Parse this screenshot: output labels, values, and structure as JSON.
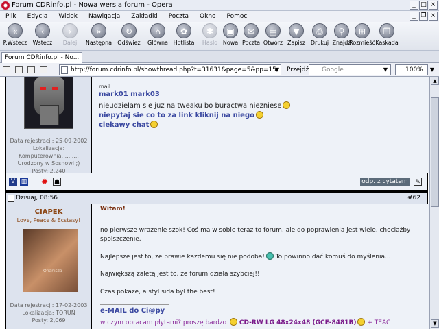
{
  "window": {
    "title": "Forum CDRinfo.pl - Nowa wersja forum - Opera"
  },
  "menu": [
    "Plik",
    "Edycja",
    "Widok",
    "Nawigacja",
    "Zakładki",
    "Poczta",
    "Okno",
    "Pomoc"
  ],
  "toolbar": [
    {
      "label": "P.Wstecz",
      "icon": "rewind-icon",
      "glyph": "«",
      "enabled": true
    },
    {
      "label": "Wstecz",
      "icon": "back-icon",
      "glyph": "‹",
      "enabled": true
    },
    {
      "label": "Dalej",
      "icon": "forward-icon",
      "glyph": "›",
      "enabled": false
    },
    {
      "label": "Następna",
      "icon": "fast-forward-icon",
      "glyph": "»",
      "enabled": true
    },
    {
      "label": "Odśwież",
      "icon": "reload-icon",
      "glyph": "↻",
      "enabled": true
    },
    {
      "label": "Główna",
      "icon": "home-icon",
      "glyph": "⌂",
      "enabled": true
    },
    {
      "label": "Hotlista",
      "icon": "hotlist-icon",
      "glyph": "✿",
      "enabled": true
    },
    {
      "label": "Hasło",
      "icon": "password-icon",
      "glyph": "✱",
      "enabled": false
    },
    {
      "label": "Nowa",
      "icon": "new-page-icon",
      "glyph": "▣",
      "enabled": true
    },
    {
      "label": "Poczta",
      "icon": "mail-icon",
      "glyph": "✉",
      "enabled": true
    },
    {
      "label": "Otwórz",
      "icon": "open-icon",
      "glyph": "▤",
      "enabled": true
    },
    {
      "label": "Zapisz",
      "icon": "save-icon",
      "glyph": "▼",
      "enabled": true
    },
    {
      "label": "Drukuj",
      "icon": "print-icon",
      "glyph": "⎙",
      "enabled": true
    },
    {
      "label": "Znajdź",
      "icon": "find-icon",
      "glyph": "⚲",
      "enabled": true
    },
    {
      "label": "Rozmieść",
      "icon": "tile-icon",
      "glyph": "⊞",
      "enabled": true
    },
    {
      "label": "Kaskada",
      "icon": "cascade-icon",
      "glyph": "❐",
      "enabled": true
    }
  ],
  "tab": {
    "label": "Forum CDRinfo.pl - No..."
  },
  "address": {
    "url": "http://forum.cdrinfo.pl/showthread.php?t=31631&page=5&pp=15",
    "goto": "Przejdź",
    "search_placeholder": "Google",
    "zoom": "100%"
  },
  "post1": {
    "info": [
      "Data rejestracji: 25-09-2002",
      "Lokalizacja:",
      "Komputerownia..........",
      "Urodzony w Sosnowi ;)",
      "Posty: 2,240"
    ],
    "mail": "mail",
    "lines": [
      "mark01 mark03",
      "nieudzielam sie juz na tweaku bo buractwa niezniese",
      "niepytaj sie co to za link kliknij na niego",
      "ciekawy chat"
    ],
    "quote": "odp. z cytatem"
  },
  "post2": {
    "date": "Dzisiaj, 08:56",
    "number": "#62",
    "username": "CIAPEK",
    "usertag": "Love, Peace & Ecstasy!",
    "avatar_text": "Onanisza",
    "info": [
      "Data rejestracji: 17-02-2003",
      "Lokalizacja: TORUŃ",
      "Posty: 2,069"
    ],
    "title": "Witam!",
    "paragraphs": [
      "no pierwsze wrażenie szok! Coś ma w sobie teraz to forum, ale do poprawienia jest wiele, chociażby spolszczenie.",
      "Najlepsze jest to, że prawie każdemu się nie podoba!",
      "To powinno dać komuś do myślenia...",
      "Największą zaletą jest to, że forum działa szybciej!!",
      "Czas pokaże, a styl sida był the best!"
    ],
    "email": "e-MAIL do Ci@py",
    "sig_start": "w czym obracam płytami? proszę bardzo",
    "sig_drive": "CD-RW LG 48x24x48 (GCE-8481B)",
    "sig_end": "+ TEAC"
  }
}
